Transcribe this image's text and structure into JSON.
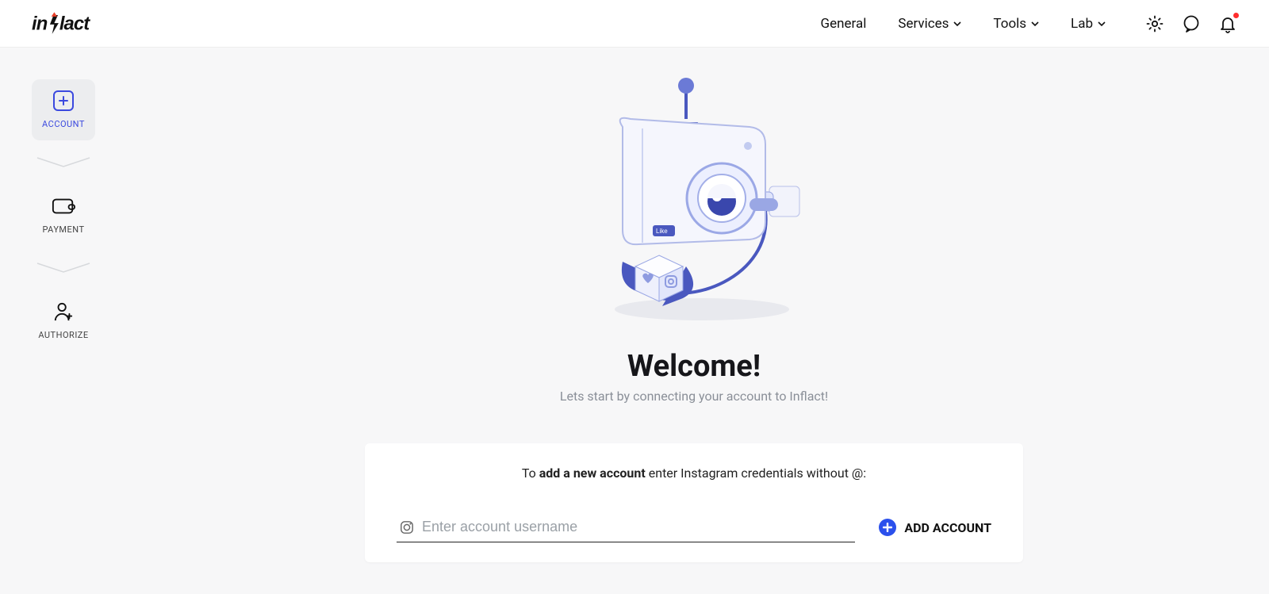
{
  "header": {
    "logo_text": "inflact",
    "nav": {
      "general": "General",
      "services": "Services",
      "tools": "Tools",
      "lab": "Lab"
    }
  },
  "sidebar": {
    "account": "ACCOUNT",
    "payment": "PAYMENT",
    "authorize": "AUTHORIZE"
  },
  "main": {
    "welcome": "Welcome!",
    "subtitle": "Lets start by connecting your account to Inflact!",
    "card_prefix": "To ",
    "card_bold": "add a new account",
    "card_suffix": " enter Instagram credentials without @:",
    "input_placeholder": "Enter account username",
    "add_button": "ADD ACCOUNT"
  }
}
